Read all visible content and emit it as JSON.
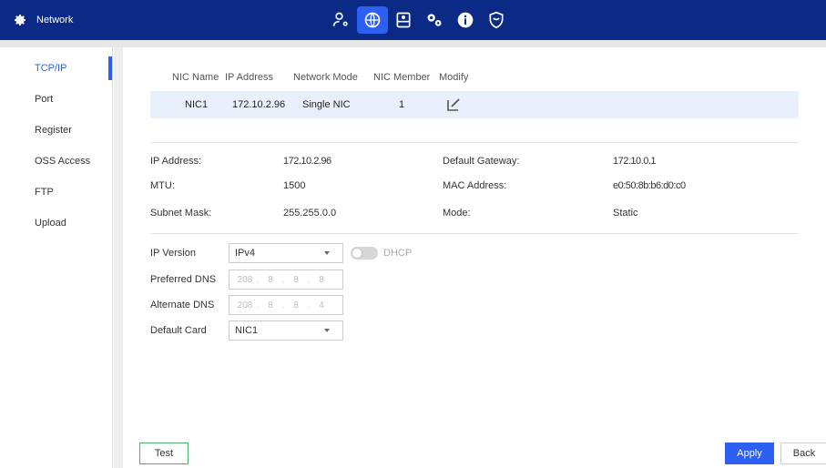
{
  "header": {
    "title": "Network",
    "nav_icons": [
      "account-icon",
      "network-icon",
      "storage-icon",
      "system-settings-icon",
      "info-icon",
      "security-icon"
    ],
    "active_icon": "network-icon",
    "accent_color": "#2d5ff0",
    "bar_color": "#0a2a86"
  },
  "sidebar": {
    "items": [
      {
        "label": "TCP/IP",
        "active": true
      },
      {
        "label": "Port",
        "active": false
      },
      {
        "label": "Register",
        "active": false
      },
      {
        "label": "OSS Access",
        "active": false
      },
      {
        "label": "FTP",
        "active": false
      },
      {
        "label": "Upload",
        "active": false
      }
    ]
  },
  "nic_table": {
    "headers": [
      "NIC Name",
      "IP Address",
      "Network Mode",
      "NIC Member",
      "Modify"
    ],
    "rows": [
      {
        "name": "NIC1",
        "ip": "172.10.2.96",
        "mode": "Single NIC",
        "member": "1"
      }
    ]
  },
  "info": {
    "ip_address_label": "IP Address:",
    "ip_address_value": "172.10.2.96",
    "default_gateway_label": "Default Gateway:",
    "default_gateway_value": "172.10.0.1",
    "mtu_label": "MTU:",
    "mtu_value": "1500",
    "mac_address_label": "MAC Address:",
    "mac_address_value": "e0:50:8b:b6:d0:c0",
    "subnet_mask_label": "Subnet Mask:",
    "subnet_mask_value": "255.255.0.0",
    "mode_label": "Mode:",
    "mode_value": "Static"
  },
  "form": {
    "ip_version_label": "IP Version",
    "ip_version_value": "IPv4",
    "dhcp_label": "DHCP",
    "dhcp_enabled": false,
    "preferred_dns_label": "Preferred DNS",
    "preferred_dns": [
      "208",
      "8",
      "8",
      "8"
    ],
    "alternate_dns_label": "Alternate DNS",
    "alternate_dns": [
      "208",
      "8",
      "8",
      "4"
    ],
    "default_card_label": "Default Card",
    "default_card_value": "NIC1"
  },
  "buttons": {
    "test": "Test",
    "apply": "Apply",
    "back": "Back"
  }
}
